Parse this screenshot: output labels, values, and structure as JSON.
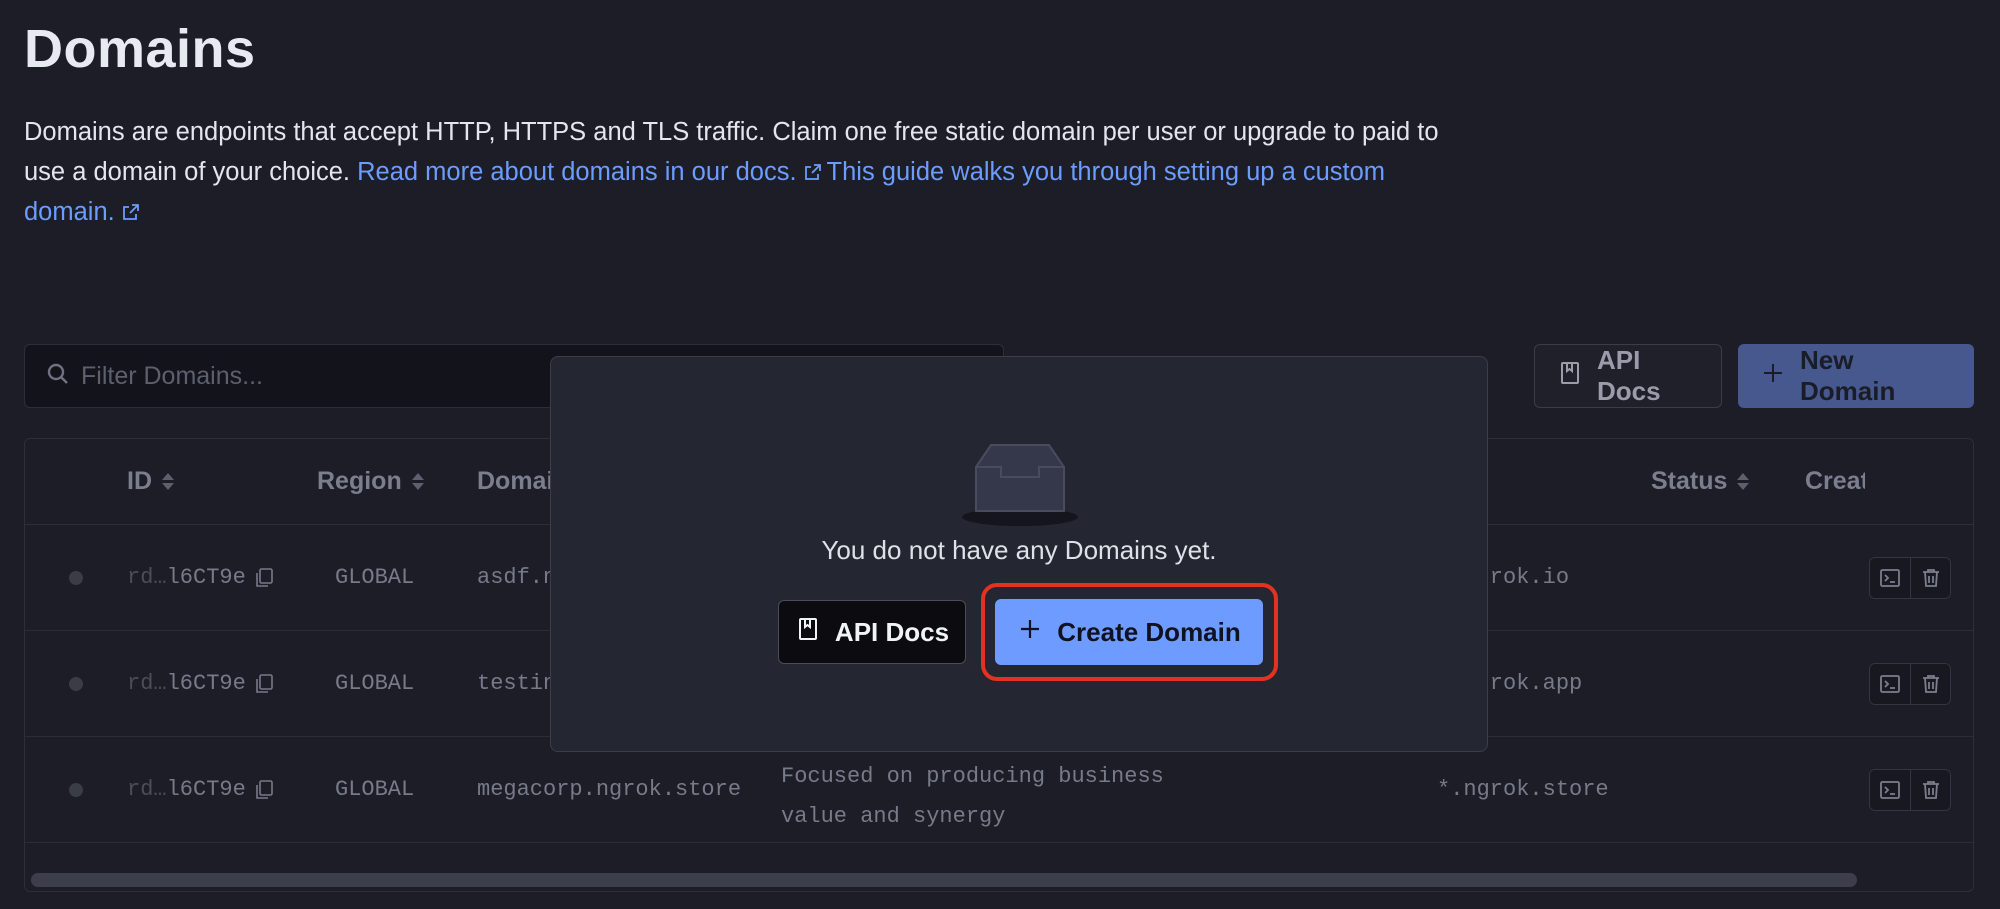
{
  "page": {
    "title": "Domains",
    "intro_text": "Domains are endpoints that accept HTTP, HTTPS and TLS traffic. Claim one free static domain per user or upgrade to paid to use a domain of your choice.",
    "docs_link": "Read more about domains in our docs.",
    "guide_link": "This guide walks you through setting up a custom domain."
  },
  "toolbar": {
    "filter_placeholder": "Filter Domains...",
    "api_docs_label": "API Docs",
    "new_domain_label": "New Domain"
  },
  "table": {
    "columns": [
      "ID",
      "Region",
      "Domain",
      "Status",
      "Created"
    ],
    "rows": [
      {
        "id_prefix": "rd…",
        "id_suffix": "l6CT9e",
        "region": "GLOBAL",
        "domain": "asdf.ngrok.io",
        "description": "",
        "cert": "*.ngrok.io"
      },
      {
        "id_prefix": "rd…",
        "id_suffix": "l6CT9e",
        "region": "GLOBAL",
        "domain": "testing.ngrok.app",
        "description": "",
        "cert": "*.ngrok.app"
      },
      {
        "id_prefix": "rd…",
        "id_suffix": "l6CT9e",
        "region": "GLOBAL",
        "domain": "megacorp.ngrok.store",
        "description": "Focused on producing business value and synergy",
        "cert": "*.ngrok.store"
      }
    ]
  },
  "empty_state": {
    "message": "You do not have any Domains yet.",
    "api_docs_label": "API Docs",
    "create_label": "Create Domain"
  },
  "colors": {
    "background": "#1c1d27",
    "link": "#6b9cff",
    "primary_button": "#6e9bff",
    "highlight_ring": "#e3321f"
  }
}
